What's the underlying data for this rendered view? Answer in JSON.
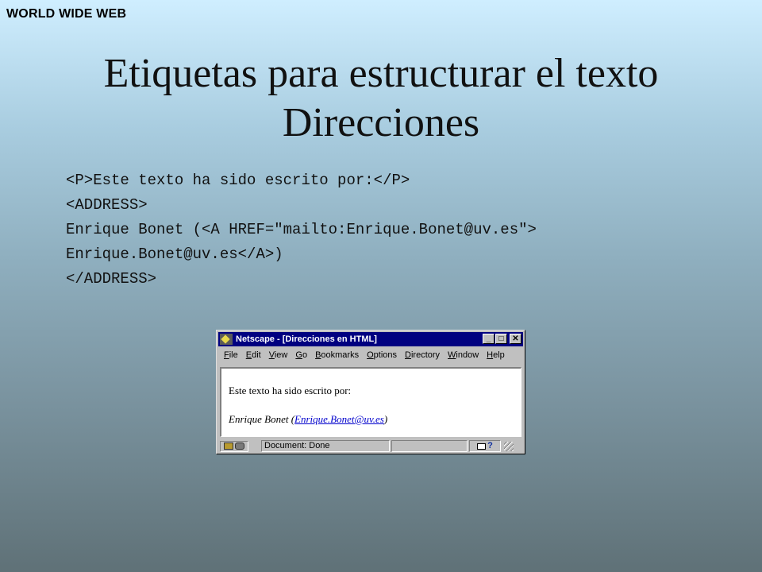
{
  "header": {
    "tag": "WORLD WIDE WEB"
  },
  "slide": {
    "title_line1": "Etiquetas para estructurar el texto",
    "title_line2": "Direcciones",
    "code_lines": [
      "<P>Este texto ha sido escrito por:</P>",
      "<ADDRESS>",
      "Enrique Bonet (<A HREF=\"mailto:Enrique.Bonet@uv.es\">",
      "Enrique.Bonet@uv.es</A>)",
      "</ADDRESS>"
    ]
  },
  "browser": {
    "title": "Netscape - [Direcciones en HTML]",
    "window_buttons": {
      "minimize": "_",
      "maximize": "□",
      "close": "✕"
    },
    "menu": [
      {
        "mnemonic": "F",
        "rest": "ile"
      },
      {
        "mnemonic": "E",
        "rest": "dit"
      },
      {
        "mnemonic": "V",
        "rest": "iew"
      },
      {
        "mnemonic": "G",
        "rest": "o"
      },
      {
        "mnemonic": "B",
        "rest": "ookmarks"
      },
      {
        "mnemonic": "O",
        "rest": "ptions"
      },
      {
        "mnemonic": "D",
        "rest": "irectory"
      },
      {
        "mnemonic": "W",
        "rest": "indow"
      },
      {
        "mnemonic": "H",
        "rest": "elp"
      }
    ],
    "content": {
      "paragraph": "Este texto ha sido escrito por:",
      "address_prefix": "Enrique Bonet (",
      "address_link": "Enrique.Bonet@uv.es",
      "address_suffix": ")"
    },
    "status": {
      "text": "Document: Done",
      "icons": [
        "key-icon",
        "lock-icon",
        "mail-icon",
        "help-icon"
      ],
      "help_glyph": "?"
    }
  }
}
